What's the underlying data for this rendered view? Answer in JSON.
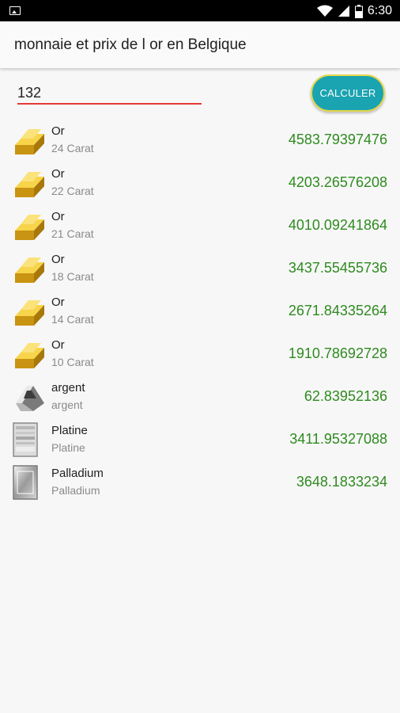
{
  "status_bar": {
    "time": "6:30"
  },
  "app_bar": {
    "title": "monnaie et prix de l or en Belgique"
  },
  "input": {
    "value": "132"
  },
  "calc_button": {
    "label": "CALCULER"
  },
  "items": [
    {
      "name": "Or",
      "sub": "24 Carat",
      "value": "4583.79397476",
      "icon": "gold-bars-icon"
    },
    {
      "name": "Or",
      "sub": "22 Carat",
      "value": "4203.26576208",
      "icon": "gold-bars-icon"
    },
    {
      "name": "Or",
      "sub": "21 Carat",
      "value": "4010.09241864",
      "icon": "gold-bars-icon"
    },
    {
      "name": "Or",
      "sub": "18 Carat",
      "value": "3437.55455736",
      "icon": "gold-bars-icon"
    },
    {
      "name": "Or",
      "sub": "14 Carat",
      "value": "2671.84335264",
      "icon": "gold-bars-icon"
    },
    {
      "name": "Or",
      "sub": "10 Carat",
      "value": "1910.78692728",
      "icon": "gold-bars-icon"
    },
    {
      "name": "argent",
      "sub": "argent",
      "value": "62.83952136",
      "icon": "silver-bar-icon"
    },
    {
      "name": "Platine",
      "sub": "Platine",
      "value": "3411.95327088",
      "icon": "platinum-bar-icon"
    },
    {
      "name": "Palladium",
      "sub": "Palladium",
      "value": "3648.1833234",
      "icon": "palladium-bar-icon"
    }
  ],
  "colors": {
    "value_text": "#2e8b1f",
    "button": "#1aa3b0",
    "input_underline": "#e53935"
  }
}
